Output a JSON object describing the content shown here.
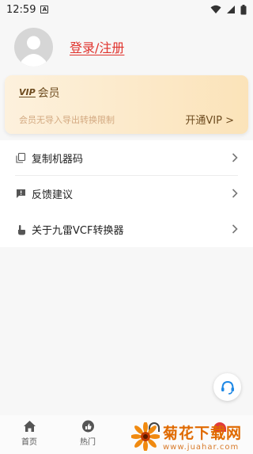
{
  "status_bar": {
    "time": "12:59",
    "notification_letter": "A"
  },
  "profile": {
    "login_label": "登录/注册"
  },
  "vip_card": {
    "badge": "VIP",
    "title": "会员",
    "description": "会员无导入导出转换限制",
    "cta": "开通VIP >"
  },
  "menu": {
    "items": [
      {
        "label": "复制机器码",
        "icon": "copy-icon"
      },
      {
        "label": "反馈建议",
        "icon": "feedback-icon"
      },
      {
        "label": "关于九雷VCF转换器",
        "icon": "hand-icon"
      }
    ]
  },
  "tabbar": {
    "tabs": [
      {
        "label": "首页",
        "icon": "home-icon"
      },
      {
        "label": "热门",
        "icon": "thumbs-up-icon"
      }
    ]
  },
  "watermark": {
    "title": "菊花下载网",
    "url": "www.juahar.com"
  },
  "colors": {
    "accent_red": "#e0322c",
    "vip_brown": "#6d4b1f",
    "vip_gold_light": "#fbe3b9",
    "watermark_orange": "#e06a00"
  }
}
